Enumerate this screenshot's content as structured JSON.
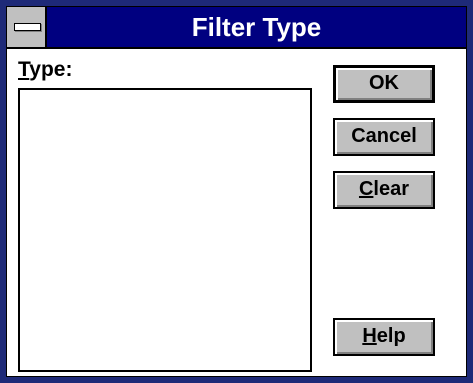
{
  "window": {
    "title": "Filter Type"
  },
  "type_label": {
    "mnemonic": "T",
    "rest": "ype:"
  },
  "type_list": {
    "items": []
  },
  "buttons": {
    "ok": "OK",
    "cancel": "Cancel",
    "clear_mnemonic": "C",
    "clear_rest": "lear",
    "help_mnemonic": "H",
    "help_rest": "elp"
  },
  "colors": {
    "title_bar": "#000080",
    "button_face": "#c0c0c0",
    "frame": "#1e2a78"
  }
}
